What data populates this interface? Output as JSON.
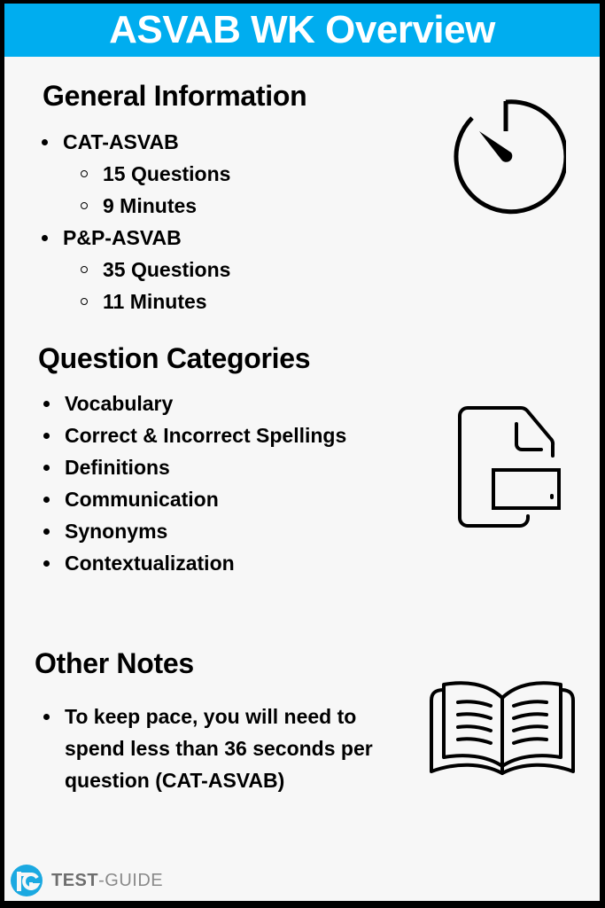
{
  "header": {
    "title": "ASVAB WK Overview",
    "background_color": "#00adef"
  },
  "general_information": {
    "title": "General Information",
    "items": [
      {
        "label": "CAT-ASVAB",
        "sub_items": [
          "15 Questions",
          "9 Minutes"
        ]
      },
      {
        "label": "P&P-ASVAB",
        "sub_items": [
          "35 Questions",
          "11 Minutes"
        ]
      }
    ],
    "icon": "stopwatch-icon"
  },
  "question_categories": {
    "title": "Question Categories",
    "items": [
      "Vocabulary",
      "Correct & Incorrect Spellings",
      "Definitions",
      "Communication",
      "Synonyms",
      "Contextualization"
    ],
    "icon": "document-icon"
  },
  "other_notes": {
    "title": "Other Notes",
    "items": [
      "To keep pace, you will need to spend less than 36 seconds per question (CAT-ASVAB)"
    ],
    "icon": "open-book-icon"
  },
  "footer": {
    "logo_bold": "TEST",
    "logo_light": "-GUIDE",
    "logo_color": "#1ba9e1"
  }
}
